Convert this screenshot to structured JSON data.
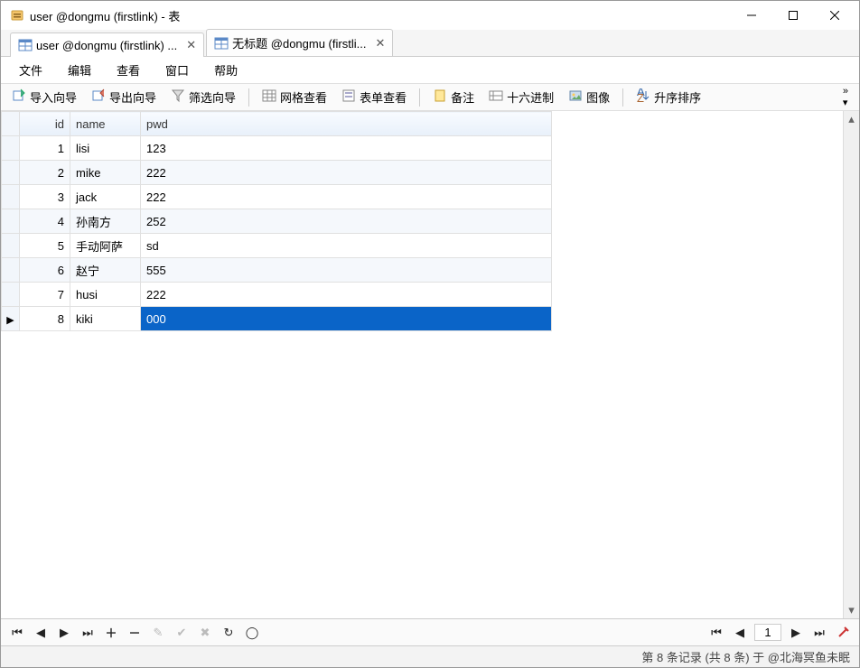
{
  "window": {
    "title": "user @dongmu (firstlink) - 表"
  },
  "tabs": [
    {
      "label": "user @dongmu (firstlink) ...",
      "active": true
    },
    {
      "label": "无标题 @dongmu (firstli...",
      "active": false
    }
  ],
  "menu": {
    "file": "文件",
    "edit": "编辑",
    "view": "查看",
    "window": "窗口",
    "help": "帮助"
  },
  "toolbar": {
    "import_wizard": "导入向导",
    "export_wizard": "导出向导",
    "filter_wizard": "筛选向导",
    "grid_view": "网格查看",
    "form_view": "表单查看",
    "memo": "备注",
    "hex": "十六进制",
    "image": "图像",
    "sort_asc": "升序排序"
  },
  "table": {
    "headers": {
      "id": "id",
      "name": "name",
      "pwd": "pwd"
    },
    "rows": [
      {
        "id": "1",
        "name": "lisi",
        "pwd": "123"
      },
      {
        "id": "2",
        "name": "mike",
        "pwd": "222"
      },
      {
        "id": "3",
        "name": "jack",
        "pwd": "222"
      },
      {
        "id": "4",
        "name": "孙南方",
        "pwd": "252"
      },
      {
        "id": "5",
        "name": "手动阿萨",
        "pwd": "sd"
      },
      {
        "id": "6",
        "name": "赵宁",
        "pwd": "555"
      },
      {
        "id": "7",
        "name": "husi",
        "pwd": "222"
      },
      {
        "id": "8",
        "name": "kiki",
        "pwd": "000"
      }
    ],
    "selected_index": 7,
    "highlighted_index": 5
  },
  "nav": {
    "page": "1"
  },
  "status": {
    "text": "第 8 条记录 (共 8 条) 于 @北海冥鱼未眠"
  }
}
